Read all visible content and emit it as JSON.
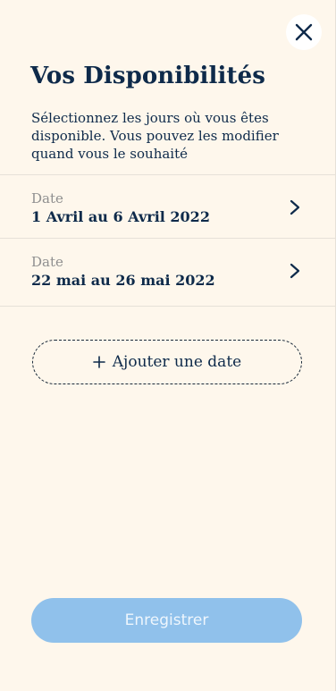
{
  "header": {
    "title": "Vos Disponibilités",
    "subtitle": "Sélectionnez les jours où vous êtes disponible. Vous pouvez les modifier quand vous le souhaité",
    "close_icon": "close-icon"
  },
  "dates": [
    {
      "label": "Date",
      "value": "1 Avril au 6 Avril 2022",
      "icon": "chevron-right-icon"
    },
    {
      "label": "Date",
      "value": "22 mai au 26 mai 2022",
      "icon": "chevron-right-icon"
    }
  ],
  "add_date": {
    "icon": "plus-icon",
    "label": "Ajouter une date"
  },
  "save": {
    "label": "Enregistrer",
    "state": "disabled"
  },
  "colors": {
    "background": "#FEF7EC",
    "text_primary": "#0E2A4A",
    "text_muted": "#8F8F8F",
    "divider": "#E6E1D8",
    "save_button_bg": "#90C1EB",
    "save_button_text": "#EEF6FD"
  }
}
